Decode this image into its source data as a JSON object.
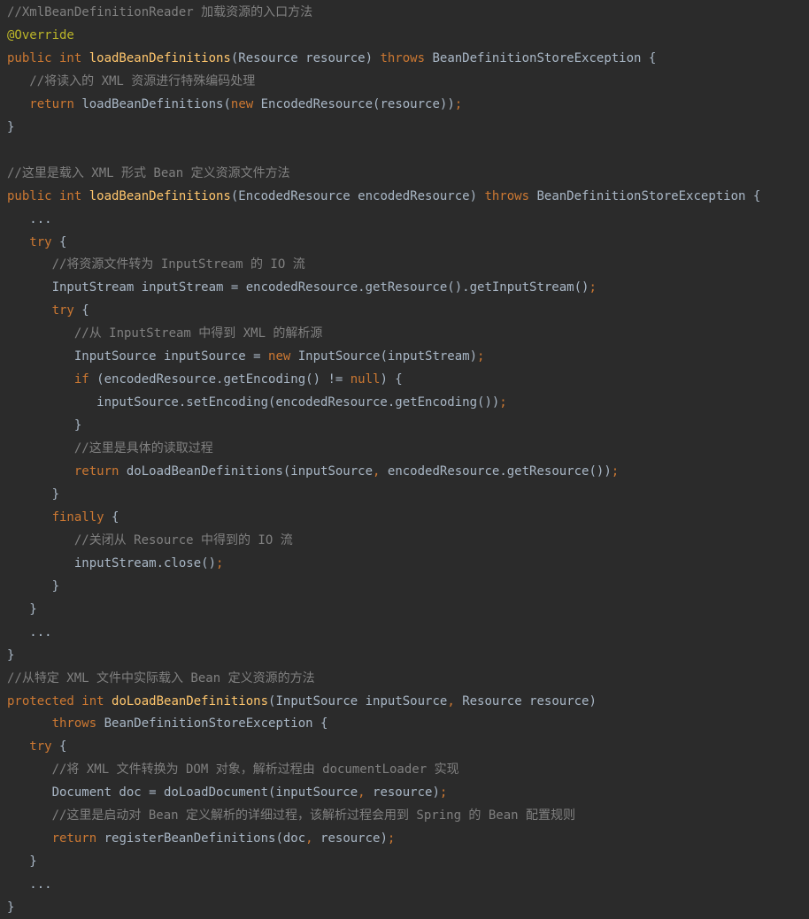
{
  "code_lines": [
    {
      "segments": [
        {
          "t": "//XmlBeanDefinitionReader 加载资源的入口方法",
          "c": "c"
        }
      ]
    },
    {
      "segments": [
        {
          "t": "@Override",
          "c": "a"
        }
      ]
    },
    {
      "segments": [
        {
          "t": "public int ",
          "c": "k"
        },
        {
          "t": "loadBeanDefinitions",
          "c": "f"
        },
        {
          "t": "(Resource resource) ",
          "c": "p"
        },
        {
          "t": "throws ",
          "c": "k"
        },
        {
          "t": "BeanDefinitionStoreException {",
          "c": "p"
        }
      ]
    },
    {
      "segments": [
        {
          "t": "   //将读入的 XML 资源进行特殊编码处理",
          "c": "c"
        }
      ]
    },
    {
      "segments": [
        {
          "t": "   ",
          "c": "p"
        },
        {
          "t": "return ",
          "c": "k"
        },
        {
          "t": "loadBeanDefinitions(",
          "c": "p"
        },
        {
          "t": "new ",
          "c": "k"
        },
        {
          "t": "EncodedResource(resource))",
          "c": "p"
        },
        {
          "t": ";",
          "c": "s"
        }
      ]
    },
    {
      "segments": [
        {
          "t": "}",
          "c": "p"
        }
      ]
    },
    {
      "segments": []
    },
    {
      "segments": [
        {
          "t": "//这里是载入 XML 形式 Bean 定义资源文件方法",
          "c": "c"
        }
      ]
    },
    {
      "segments": [
        {
          "t": "public int ",
          "c": "k"
        },
        {
          "t": "loadBeanDefinitions",
          "c": "f"
        },
        {
          "t": "(EncodedResource encodedResource) ",
          "c": "p"
        },
        {
          "t": "throws ",
          "c": "k"
        },
        {
          "t": "BeanDefinitionStoreException {",
          "c": "p"
        }
      ]
    },
    {
      "segments": [
        {
          "t": "   ...",
          "c": "p"
        }
      ]
    },
    {
      "segments": [
        {
          "t": "   ",
          "c": "p"
        },
        {
          "t": "try ",
          "c": "k"
        },
        {
          "t": "{",
          "c": "p"
        }
      ]
    },
    {
      "segments": [
        {
          "t": "      //将资源文件转为 InputStream 的 IO 流",
          "c": "c"
        }
      ]
    },
    {
      "segments": [
        {
          "t": "      InputStream inputStream = encodedResource.getResource().getInputStream()",
          "c": "p"
        },
        {
          "t": ";",
          "c": "s"
        }
      ]
    },
    {
      "segments": [
        {
          "t": "      ",
          "c": "p"
        },
        {
          "t": "try ",
          "c": "k"
        },
        {
          "t": "{",
          "c": "p"
        }
      ]
    },
    {
      "segments": [
        {
          "t": "         //从 InputStream 中得到 XML 的解析源",
          "c": "c"
        }
      ]
    },
    {
      "segments": [
        {
          "t": "         InputSource inputSource = ",
          "c": "p"
        },
        {
          "t": "new ",
          "c": "k"
        },
        {
          "t": "InputSource(inputStream)",
          "c": "p"
        },
        {
          "t": ";",
          "c": "s"
        }
      ]
    },
    {
      "segments": [
        {
          "t": "         ",
          "c": "p"
        },
        {
          "t": "if ",
          "c": "k"
        },
        {
          "t": "(encodedResource.getEncoding() != ",
          "c": "p"
        },
        {
          "t": "null",
          "c": "k"
        },
        {
          "t": ") {",
          "c": "p"
        }
      ]
    },
    {
      "segments": [
        {
          "t": "            inputSource.setEncoding(encodedResource.getEncoding())",
          "c": "p"
        },
        {
          "t": ";",
          "c": "s"
        }
      ]
    },
    {
      "segments": [
        {
          "t": "         }",
          "c": "p"
        }
      ]
    },
    {
      "segments": [
        {
          "t": "         //这里是具体的读取过程",
          "c": "c"
        }
      ]
    },
    {
      "segments": [
        {
          "t": "         ",
          "c": "p"
        },
        {
          "t": "return ",
          "c": "k"
        },
        {
          "t": "doLoadBeanDefinitions(inputSource",
          "c": "p"
        },
        {
          "t": ", ",
          "c": "s"
        },
        {
          "t": "encodedResource.getResource())",
          "c": "p"
        },
        {
          "t": ";",
          "c": "s"
        }
      ]
    },
    {
      "segments": [
        {
          "t": "      }",
          "c": "p"
        }
      ]
    },
    {
      "segments": [
        {
          "t": "      ",
          "c": "p"
        },
        {
          "t": "finally ",
          "c": "k"
        },
        {
          "t": "{",
          "c": "p"
        }
      ]
    },
    {
      "segments": [
        {
          "t": "         //关闭从 Resource 中得到的 IO 流",
          "c": "c"
        }
      ]
    },
    {
      "segments": [
        {
          "t": "         inputStream.close()",
          "c": "p"
        },
        {
          "t": ";",
          "c": "s"
        }
      ]
    },
    {
      "segments": [
        {
          "t": "      }",
          "c": "p"
        }
      ]
    },
    {
      "segments": [
        {
          "t": "   }",
          "c": "p"
        }
      ]
    },
    {
      "segments": [
        {
          "t": "   ...",
          "c": "p"
        }
      ]
    },
    {
      "segments": [
        {
          "t": "}",
          "c": "p"
        }
      ]
    },
    {
      "segments": [
        {
          "t": "//从特定 XML 文件中实际载入 Bean 定义资源的方法",
          "c": "c"
        }
      ]
    },
    {
      "segments": [
        {
          "t": "protected int ",
          "c": "k"
        },
        {
          "t": "doLoadBeanDefinitions",
          "c": "f"
        },
        {
          "t": "(InputSource inputSource",
          "c": "p"
        },
        {
          "t": ", ",
          "c": "s"
        },
        {
          "t": "Resource resource)",
          "c": "p"
        }
      ]
    },
    {
      "segments": [
        {
          "t": "      ",
          "c": "p"
        },
        {
          "t": "throws ",
          "c": "k"
        },
        {
          "t": "BeanDefinitionStoreException {",
          "c": "p"
        }
      ]
    },
    {
      "segments": [
        {
          "t": "   ",
          "c": "p"
        },
        {
          "t": "try ",
          "c": "k"
        },
        {
          "t": "{",
          "c": "p"
        }
      ]
    },
    {
      "segments": [
        {
          "t": "      //将 XML 文件转换为 DOM 对象，解析过程由 documentLoader 实现",
          "c": "c"
        }
      ]
    },
    {
      "segments": [
        {
          "t": "      Document doc = doLoadDocument(inputSource",
          "c": "p"
        },
        {
          "t": ", ",
          "c": "s"
        },
        {
          "t": "resource)",
          "c": "p"
        },
        {
          "t": ";",
          "c": "s"
        }
      ]
    },
    {
      "segments": [
        {
          "t": "      //这里是启动对 Bean 定义解析的详细过程，该解析过程会用到 Spring 的 Bean 配置规则",
          "c": "c"
        }
      ]
    },
    {
      "segments": [
        {
          "t": "      ",
          "c": "p"
        },
        {
          "t": "return ",
          "c": "k"
        },
        {
          "t": "registerBeanDefinitions(doc",
          "c": "p"
        },
        {
          "t": ", ",
          "c": "s"
        },
        {
          "t": "resource)",
          "c": "p"
        },
        {
          "t": ";",
          "c": "s"
        }
      ]
    },
    {
      "segments": [
        {
          "t": "   }",
          "c": "p"
        }
      ]
    },
    {
      "segments": [
        {
          "t": "   ...",
          "c": "p"
        }
      ]
    },
    {
      "segments": [
        {
          "t": "}",
          "c": "p"
        }
      ]
    }
  ],
  "colors": {
    "background": "#2b2b2b",
    "plain": "#a9b7c6",
    "comment": "#808080",
    "keyword": "#cc7832",
    "method": "#ffc66d",
    "annotation": "#bbb529"
  }
}
